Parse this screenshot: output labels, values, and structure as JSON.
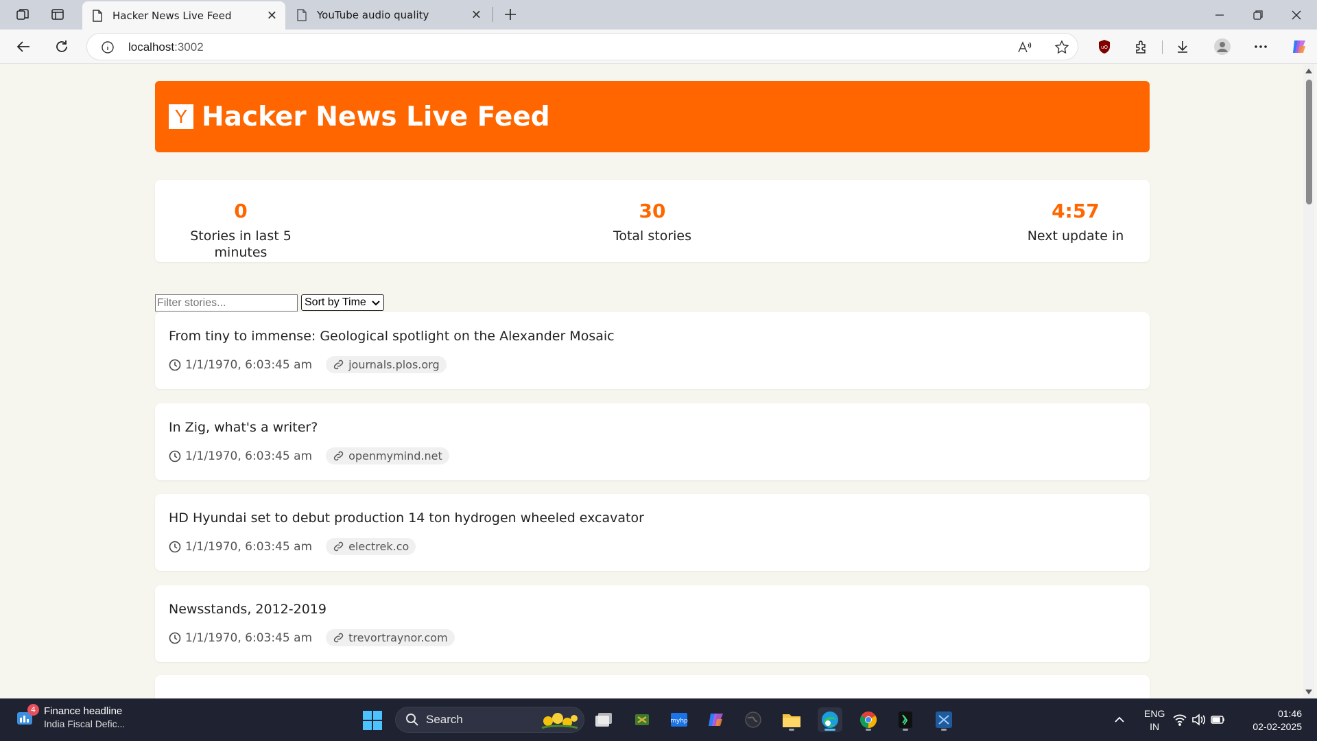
{
  "browser": {
    "tabs": [
      {
        "label": "Hacker News Live Feed",
        "active": true
      },
      {
        "label": "YouTube audio quality",
        "active": false
      }
    ],
    "address": {
      "host": "localhost",
      "port": ":3002"
    }
  },
  "page": {
    "header_title": "Hacker News Live Feed",
    "logo_letter": "Y",
    "accent_color": "#ff6600",
    "stats": [
      {
        "value": "0",
        "label": "Stories in last 5 minutes"
      },
      {
        "value": "30",
        "label": "Total stories"
      },
      {
        "value": "4:57",
        "label": "Next update in"
      }
    ],
    "filter_placeholder": "Filter stories...",
    "sort_selected": "Sort by Time",
    "stories": [
      {
        "title": "From tiny to immense: Geological spotlight on the Alexander Mosaic",
        "time": "1/1/1970, 6:03:45 am",
        "domain": "journals.plos.org"
      },
      {
        "title": "In Zig, what's a writer?",
        "time": "1/1/1970, 6:03:45 am",
        "domain": "openmymind.net"
      },
      {
        "title": "HD Hyundai set to debut production 14 ton hydrogen wheeled excavator",
        "time": "1/1/1970, 6:03:45 am",
        "domain": "electrek.co"
      },
      {
        "title": "Newsstands, 2012-2019",
        "time": "1/1/1970, 6:03:45 am",
        "domain": "trevortraynor.com"
      }
    ]
  },
  "taskbar": {
    "widget_badge": "4",
    "widget_title": "Finance headline",
    "widget_subtitle": "India Fiscal Defic...",
    "search_label": "Search",
    "lang_line1": "ENG",
    "lang_line2": "IN",
    "time": "01:46",
    "date": "02-02-2025"
  }
}
